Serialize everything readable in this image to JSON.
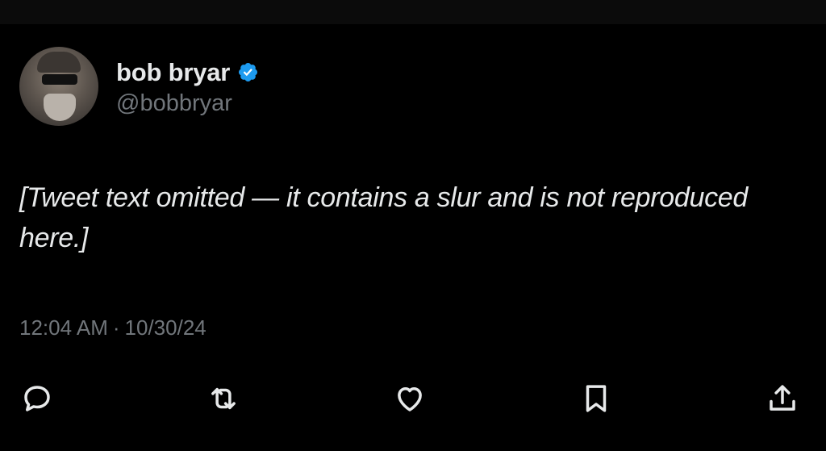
{
  "author": {
    "display_name": "bob bryar",
    "handle": "@bobbryar",
    "verified": true,
    "verified_color": "#1d9bf0"
  },
  "tweet": {
    "text": "[Tweet text omitted — it contains a slur and is not reproduced here.]",
    "time": "12:04 AM",
    "separator": "·",
    "date": "10/30/24"
  },
  "actions": [
    {
      "name": "reply",
      "icon": "reply-icon"
    },
    {
      "name": "repost",
      "icon": "repost-icon"
    },
    {
      "name": "like",
      "icon": "heart-icon"
    },
    {
      "name": "bookmark",
      "icon": "bookmark-icon"
    },
    {
      "name": "share",
      "icon": "share-icon"
    }
  ],
  "colors": {
    "background": "#000000",
    "text_primary": "#e7e9ea",
    "text_secondary": "#71767b"
  }
}
